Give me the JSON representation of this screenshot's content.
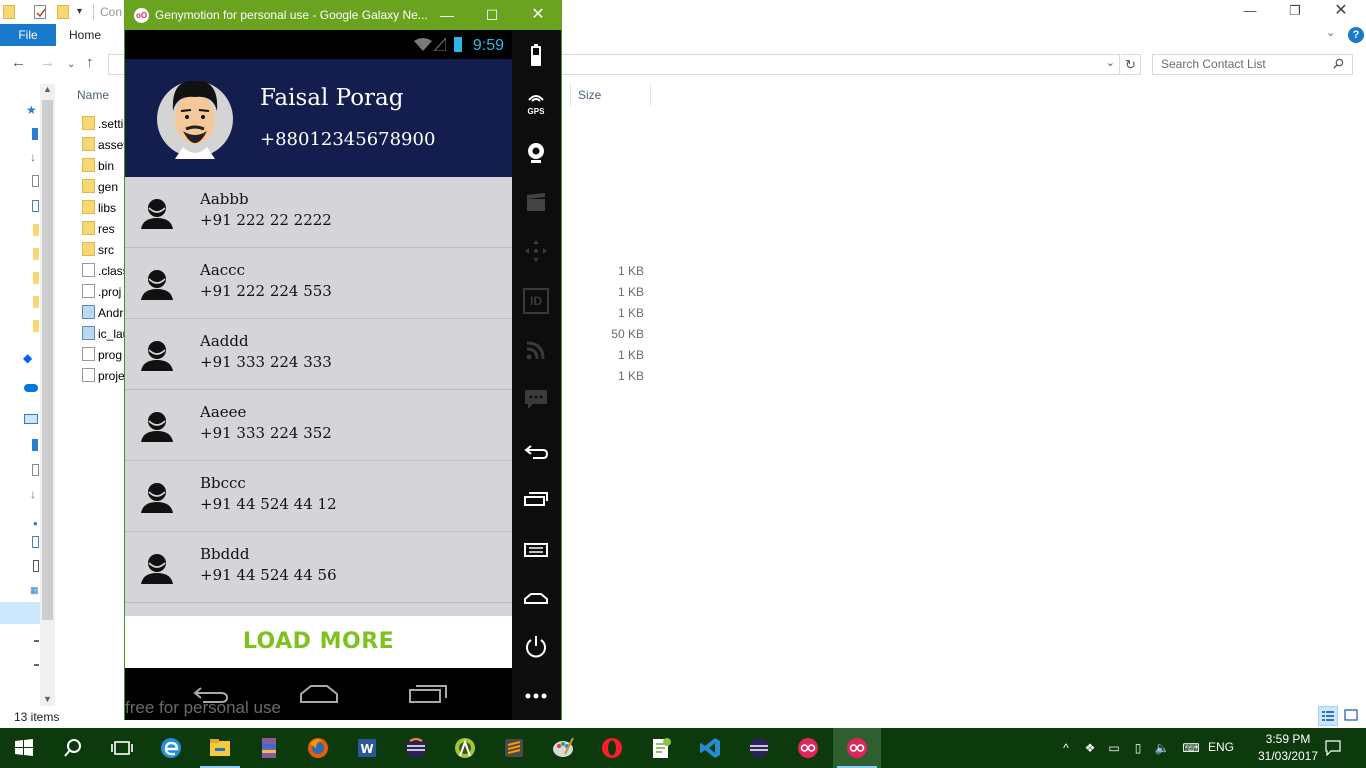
{
  "explorer": {
    "title_fragment": "Con",
    "ribbon": {
      "file_tab": "File",
      "home_tab": "Home",
      "help": "?"
    },
    "search": {
      "placeholder": "Search Contact List"
    },
    "columns": {
      "name": "Name",
      "size": "Size"
    },
    "files": [
      {
        "name": ".setti",
        "type": "folder",
        "size": ""
      },
      {
        "name": "asset",
        "type": "folder",
        "size": ""
      },
      {
        "name": "bin",
        "type": "folder",
        "size": ""
      },
      {
        "name": "gen",
        "type": "folder",
        "size": ""
      },
      {
        "name": "libs",
        "type": "folder",
        "size": ""
      },
      {
        "name": "res",
        "type": "folder",
        "size": ""
      },
      {
        "name": "src",
        "type": "folder",
        "size": ""
      },
      {
        "name": ".class",
        "type": "file",
        "size": "1 KB"
      },
      {
        "name": ".proj",
        "type": "file",
        "size": "1 KB"
      },
      {
        "name": "Andr",
        "type": "file-special",
        "size": "1 KB"
      },
      {
        "name": "ic_lau",
        "type": "image",
        "size": "50 KB"
      },
      {
        "name": "prog",
        "type": "file",
        "size": "1 KB"
      },
      {
        "name": "proje",
        "type": "file",
        "size": "1 KB"
      }
    ],
    "status": {
      "items_count": "13 items"
    }
  },
  "genymotion": {
    "window_title": "Genymotion for personal use - Google Galaxy Ne...",
    "logo_text": "oO",
    "status_bar": {
      "time": "9:59"
    },
    "profile": {
      "name": "Faisal Porag",
      "phone": "+88012345678900"
    },
    "contacts": [
      {
        "name": "Aabbb",
        "phone": "+91 222 22 2222"
      },
      {
        "name": "Aaccc",
        "phone": "+91 222 224 553"
      },
      {
        "name": "Aaddd",
        "phone": "+91 333 224 333"
      },
      {
        "name": "Aaeee",
        "phone": "+91 333 224 352"
      },
      {
        "name": "Bbccc",
        "phone": "+91 44 524 44 12"
      },
      {
        "name": "Bbddd",
        "phone": "+91 44 524 44 56"
      }
    ],
    "load_more_label": "LOAD MORE",
    "watermark": "free for personal use",
    "toolbar_icons": [
      "battery-icon",
      "gps-icon",
      "webcam-icon",
      "video-capture-icon",
      "dpad-icon",
      "device-id-icon",
      "network-icon",
      "sms-icon",
      "back-icon",
      "recent-apps-icon",
      "menu-icon",
      "home-icon",
      "power-icon",
      "more-icon"
    ],
    "gps_label": "GPS",
    "id_label": "ID"
  },
  "taskbar": {
    "language": "ENG",
    "time": "3:59 PM",
    "date": "31/03/2017",
    "apps": [
      "start",
      "search",
      "task-view",
      "edge",
      "file-explorer",
      "winrar",
      "firefox",
      "word",
      "eclipse",
      "android-studio",
      "sublime",
      "paint",
      "opera",
      "notepad-plus",
      "visual-studio-code",
      "eclipse-2",
      "genymotion",
      "genymotion-player"
    ]
  },
  "colors": {
    "accent_green": "#7dc21e",
    "header_navy": "#141e4e",
    "list_bg": "#d5d5d9",
    "taskbar": "#0c3a0c",
    "geny_title": "#69a31f"
  }
}
